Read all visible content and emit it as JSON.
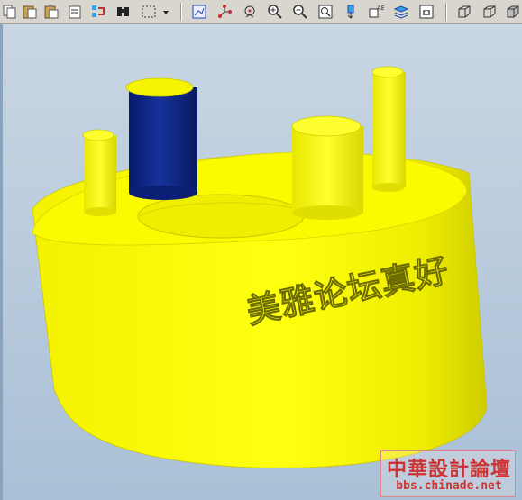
{
  "toolbar": {
    "buttons": [
      {
        "name": "copy-icon"
      },
      {
        "name": "clipboard-icon"
      },
      {
        "name": "paste-special-icon"
      },
      {
        "name": "regenerate-icon"
      },
      {
        "name": "find-icon"
      },
      {
        "name": "select-box-icon"
      },
      {
        "name": "dropdown-arrow-icon"
      },
      {
        "name": "sketch-icon"
      },
      {
        "name": "datum-display-icon"
      },
      {
        "name": "spin-center-icon"
      },
      {
        "name": "zoom-in-icon"
      },
      {
        "name": "zoom-out-icon"
      },
      {
        "name": "refit-icon"
      },
      {
        "name": "reorient-icon"
      },
      {
        "name": "saved-views-icon"
      },
      {
        "name": "layers-icon"
      },
      {
        "name": "model-tree-icon"
      },
      {
        "name": "wireframe-icon"
      },
      {
        "name": "hidden-line-icon"
      }
    ]
  },
  "model": {
    "engraved_text": "美雅论坛真好",
    "colors": {
      "body": "#f4f200",
      "body_shade": "#d9d600",
      "pin_blue": "#0b1f7a",
      "background": "#a9c0d6"
    }
  },
  "watermark": {
    "title": "中華設計論壇",
    "url": "bbs.chinade.net"
  }
}
